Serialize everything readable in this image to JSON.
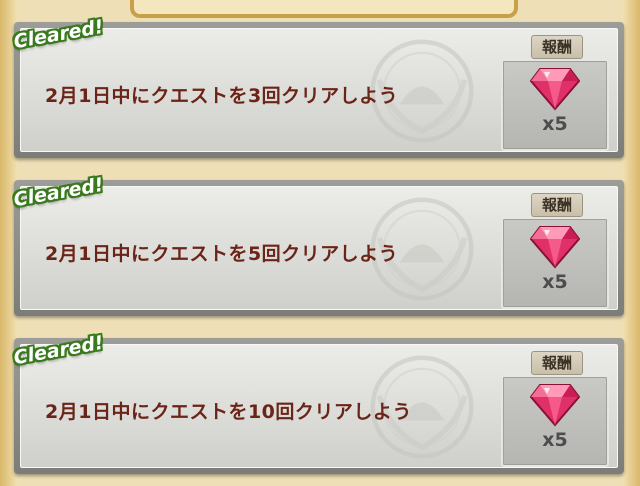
{
  "missions": [
    {
      "badge": "Cleared!",
      "text": "2月1日中にクエストを3回クリアしよう",
      "reward_label": "報酬",
      "reward_item": "gem-icon",
      "reward_qty": "x5"
    },
    {
      "badge": "Cleared!",
      "text": "2月1日中にクエストを5回クリアしよう",
      "reward_label": "報酬",
      "reward_item": "gem-icon",
      "reward_qty": "x5"
    },
    {
      "badge": "Cleared!",
      "text": "2月1日中にクエストを10回クリアしよう",
      "reward_label": "報酬",
      "reward_item": "gem-icon",
      "reward_qty": "x5"
    }
  ],
  "colors": {
    "badge_outline": "#3a7a1e",
    "mission_text": "#6b2418",
    "gem": "#e0306a",
    "page_bg": "#eedfb6"
  }
}
